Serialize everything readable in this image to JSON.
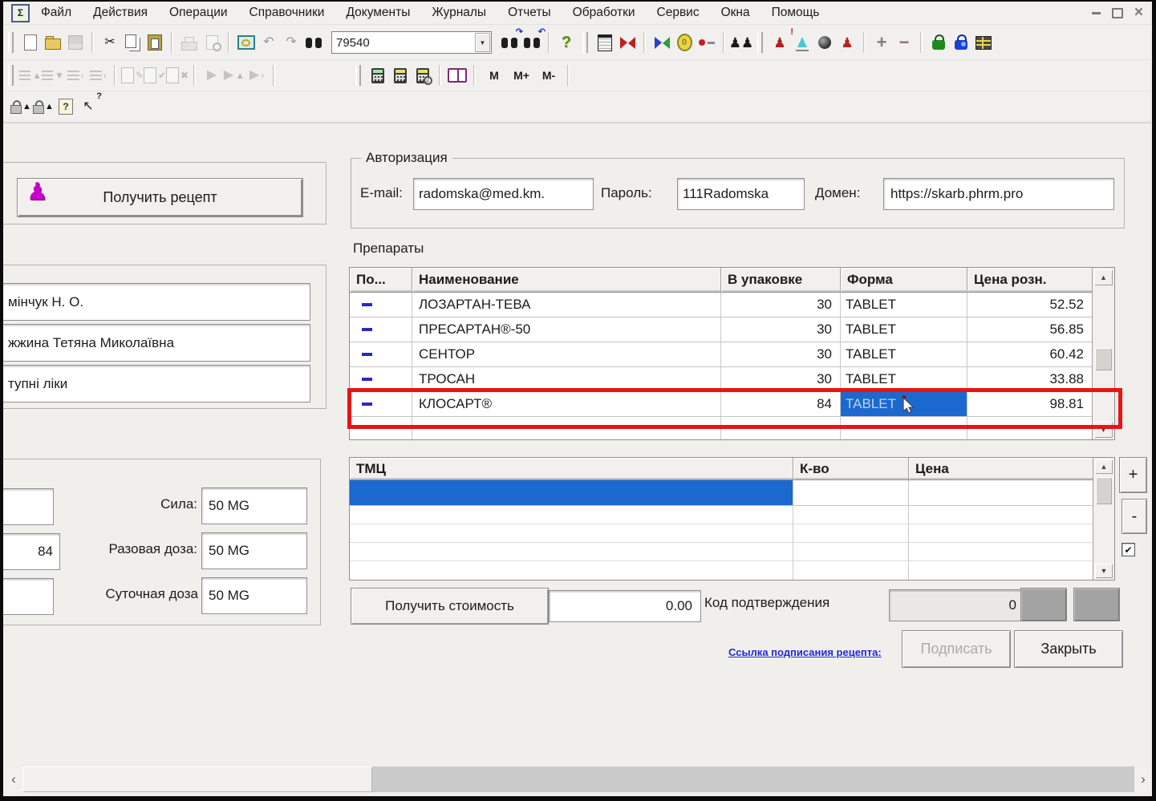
{
  "menu": {
    "items": [
      "Файл",
      "Действия",
      "Операции",
      "Справочники",
      "Документы",
      "Журналы",
      "Отчеты",
      "Обработки",
      "Сервис",
      "Окна",
      "Помощь"
    ]
  },
  "toolbar": {
    "search_value": "79540",
    "memory": [
      "M",
      "M+",
      "M-"
    ]
  },
  "icons": {
    "up": "▲",
    "down": "▼",
    "left": "‹",
    "right": "›",
    "check": "✔",
    "scissors": "✂",
    "undo": "↶",
    "redo": "↷",
    "question": "?",
    "pawn": "♟",
    "two_pawns": "♟♟",
    "exclaim": "!",
    "play": "▶",
    "edit": "✎",
    "cross": "✖",
    "arrow_nw": "↖",
    "zero": "0",
    "sigma": "Σ",
    "close": "×"
  },
  "auth": {
    "title": "Авторизация",
    "email_label": "E-mail:",
    "email_value": "radomska@med.km.",
    "password_label": "Пароль:",
    "password_value": "111Radomska",
    "domain_label": "Домен:",
    "domain_value": "https://skarb.phrm.pro"
  },
  "prescription": {
    "get_recipe_button": "Получить рецепт",
    "doctor": "мінчук Н. О.",
    "patient": "жжина Тетяна Миколаївна",
    "program": "тупні ліки",
    "quantity": "84",
    "strength_label": "Сила:",
    "strength": "50 MG",
    "single_dose_label": "Разовая доза:",
    "single_dose": "50 MG",
    "daily_dose_label": "Суточная доза",
    "daily_dose": "50 MG"
  },
  "drugs": {
    "title": "Препараты",
    "columns": [
      "По...",
      "Наименование",
      "В упаковке",
      "Форма",
      "Цена розн."
    ],
    "rows": [
      {
        "name": "ЛОЗАРТАН-ТЕВА",
        "pack": "30",
        "form": "TABLET",
        "price": "52.52"
      },
      {
        "name": "ПРЕСАРТАН®-50",
        "pack": "30",
        "form": "TABLET",
        "price": "56.85"
      },
      {
        "name": "СЕНТОР",
        "pack": "30",
        "form": "TABLET",
        "price": "60.42"
      },
      {
        "name": "ТРОСАН",
        "pack": "30",
        "form": "TABLET",
        "price": "33.88"
      },
      {
        "name": "КЛОСАРТ®",
        "pack": "84",
        "form": "TABLET",
        "price": "98.81"
      }
    ],
    "selected_row": 4,
    "selected_cell": "Форма"
  },
  "tmc": {
    "columns": [
      "ТМЦ",
      "К-во",
      "Цена"
    ],
    "plus": "+",
    "minus": "-"
  },
  "footer": {
    "get_cost_button": "Получить стоимость",
    "cost_value": "0.00",
    "code_label": "Код подтверждения",
    "code_value": "0",
    "sign_link": "Ссылка подписания рецепта:",
    "sign_button": "Подписать",
    "close_button": "Закрыть"
  },
  "colors": {
    "selection": "#1b69cf",
    "highlight_border": "#e81414",
    "toolbar_bg": "#f1f0ee"
  }
}
